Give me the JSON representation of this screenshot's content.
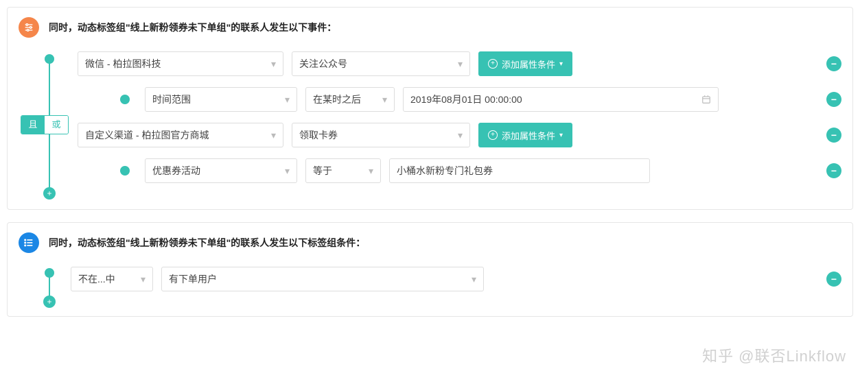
{
  "colors": {
    "accent": "#37c2b3",
    "orange": "#f5864a",
    "blue": "#1b87e5"
  },
  "logic": {
    "and": "且",
    "or": "或",
    "selected": "and"
  },
  "events": {
    "header": "同时，动态标签组\"线上新粉领券未下单组\"的联系人发生以下事件：",
    "addAttrBtn": "添加属性条件",
    "group1": {
      "channel": "微信 - 柏拉图科技",
      "event": "关注公众号",
      "attr": {
        "field": "时间范围",
        "op": "在某时之后",
        "value": "2019年08月01日 00:00:00"
      }
    },
    "group2": {
      "channel": "自定义渠道 - 柏拉图官方商城",
      "event": "领取卡券",
      "attr": {
        "field": "优惠券活动",
        "op": "等于",
        "value": "小桶水新粉专门礼包券"
      }
    }
  },
  "tags": {
    "header": "同时，动态标签组\"线上新粉领券未下单组\"的联系人发生以下标签组条件：",
    "op": "不在...中",
    "value": "有下单用户"
  },
  "watermark": "知乎 @联否Linkflow"
}
